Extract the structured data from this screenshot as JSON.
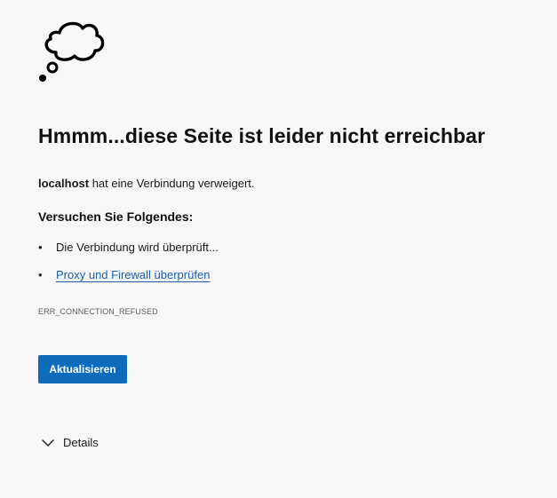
{
  "icons": {
    "cloud": "thought-cloud-icon",
    "chevron": "chevron-down-icon"
  },
  "error": {
    "headline": "Hmmm...diese Seite ist leider nicht erreichbar",
    "host": "localhost",
    "message": " hat eine Verbindung verweigert.",
    "try_heading": "Versuchen Sie Folgendes:",
    "suggestions": [
      {
        "bullet": "•",
        "text": "Die Verbindung wird überprüft..."
      },
      {
        "bullet": "•",
        "text": "Proxy und Firewall überprüfen"
      }
    ],
    "code": "ERR_CONNECTION_REFUSED"
  },
  "actions": {
    "refresh_label": "Aktualisieren",
    "details_label": "Details"
  },
  "colors": {
    "background": "#f7f7f7",
    "button": "#0f6cbd",
    "link": "#1a5fa8"
  }
}
